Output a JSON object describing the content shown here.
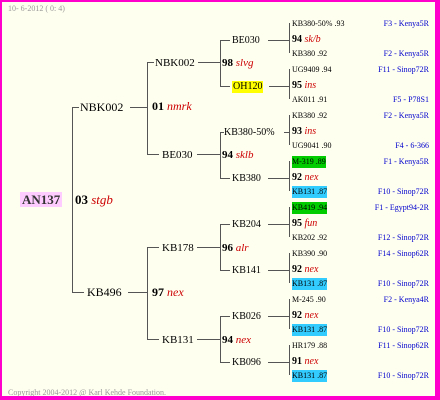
{
  "header": {
    "text": "10- 6-2012 ( 0: 4)"
  },
  "footer": {
    "text": "Copyright 2004-2012 @ Karl Kehde Foundation."
  },
  "root": {
    "id": "AN137"
  },
  "gen1": [
    {
      "id": "NBK002",
      "year": "01",
      "name": "nmrk"
    },
    {
      "id": "KB496",
      "year": "97",
      "name": "nex"
    }
  ],
  "center": {
    "year": "03",
    "name": "stgb"
  },
  "gen2": [
    {
      "id": "NBK002",
      "year": "98",
      "name": "slvg"
    },
    {
      "id": "BE030",
      "year": "94",
      "name": "sklb"
    },
    {
      "id": "KB178",
      "year": "96",
      "name": "alr"
    },
    {
      "id": "KB131",
      "year": "94",
      "name": "nex"
    }
  ],
  "gen3": [
    {
      "id": "BE030",
      "year": "94",
      "name": "sklb"
    },
    {
      "id": "OH120",
      "year": "95",
      "name": "ins"
    },
    {
      "id": "KB380-50%",
      "year": "93",
      "name": "ins"
    },
    {
      "id": "KB380",
      "year": "92",
      "name": "nex"
    },
    {
      "id": "KB204",
      "year": "95",
      "name": "fun"
    },
    {
      "id": "KB141",
      "year": "92",
      "name": "nex"
    },
    {
      "id": "KB026",
      "year": "92",
      "name": "nex"
    },
    {
      "id": "KB096",
      "year": "91",
      "name": "nex"
    }
  ],
  "gen4": [
    {
      "id": "KB380-50% .93",
      "right": "F3 - Kenya5R"
    },
    {
      "id": "KB380 .92",
      "right": "F2 - Kenya5R"
    },
    {
      "id": "UG9409 .94",
      "right": "F11 - Sinop72R"
    },
    {
      "id": "AK011 .91",
      "right": "F5 - P78S1"
    },
    {
      "id": "KB380 .92",
      "right": "F2 - Kenya5R"
    },
    {
      "id": "UG9041 .90",
      "right": "F4 - 6-366"
    },
    {
      "id": "M-319 .89",
      "right": "F1 - Kenya5R"
    },
    {
      "id": "KB131 .87",
      "right": "F10 - Sinop72R"
    },
    {
      "id": "KB419 .94",
      "right": "F1 - Egypt94-2R"
    },
    {
      "id": "KB202 .92",
      "right": "F12 - Sinop72R"
    },
    {
      "id": "KB390 .90",
      "right": "F14 - Sinop62R"
    },
    {
      "id": "KB131 .87",
      "right": "F10 - Sinop72R"
    },
    {
      "id": "M-245 .90",
      "right": "F2 - Kenya4R"
    },
    {
      "id": "KB131 .87",
      "right": "F10 - Sinop72R"
    },
    {
      "id": "HR179 .88",
      "right": "F11 - Sinop62R"
    },
    {
      "id": "KB131 .87",
      "right": "F10 - Sinop72R"
    }
  ],
  "gen3_labels": [
    {
      "year": "94",
      "name": "sk/b"
    },
    {
      "year": "95",
      "name": "ins"
    },
    {
      "year": "93",
      "name": "ins"
    },
    {
      "year": "92",
      "name": "nex"
    },
    {
      "year": "95",
      "name": "fun"
    },
    {
      "year": "92",
      "name": "nex"
    },
    {
      "year": "92",
      "name": "nex"
    },
    {
      "year": "91",
      "name": "nex"
    }
  ],
  "colors": {
    "border": "#ff00cc",
    "background": "#fffff0",
    "highlight_green": "#00cc00",
    "highlight_cyan": "#33ccff",
    "highlight_yellow": "#ffff00",
    "root_bg": "#ffccff"
  }
}
